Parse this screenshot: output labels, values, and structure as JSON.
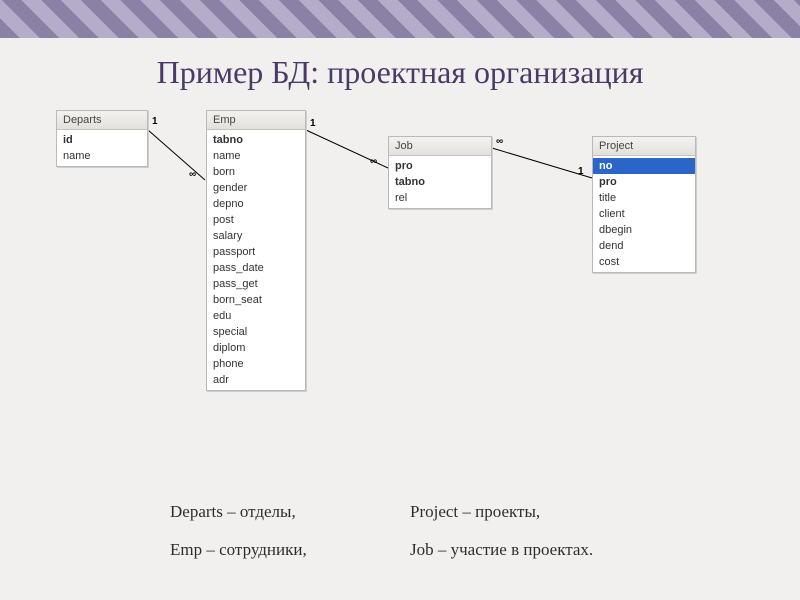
{
  "title": "Пример БД: проектная организация",
  "tables": {
    "departs": {
      "name": "Departs",
      "fields": [
        {
          "name": "id",
          "pk": true
        },
        {
          "name": "name"
        }
      ]
    },
    "emp": {
      "name": "Emp",
      "fields": [
        {
          "name": "tabno",
          "pk": true
        },
        {
          "name": "name"
        },
        {
          "name": "born"
        },
        {
          "name": "gender"
        },
        {
          "name": "depno"
        },
        {
          "name": "post"
        },
        {
          "name": "salary"
        },
        {
          "name": "passport"
        },
        {
          "name": "pass_date"
        },
        {
          "name": "pass_get"
        },
        {
          "name": "born_seat"
        },
        {
          "name": "edu"
        },
        {
          "name": "special"
        },
        {
          "name": "diplom"
        },
        {
          "name": "phone"
        },
        {
          "name": "adr"
        }
      ]
    },
    "job": {
      "name": "Job",
      "fields": [
        {
          "name": "pro",
          "pk": true
        },
        {
          "name": "tabno",
          "pk": true
        },
        {
          "name": "rel"
        }
      ]
    },
    "project": {
      "name": "Project",
      "fields": [
        {
          "name": "no",
          "pk": true,
          "selected": true
        },
        {
          "name": "pro",
          "pk": true
        },
        {
          "name": "title"
        },
        {
          "name": "client"
        },
        {
          "name": "dbegin"
        },
        {
          "name": "dend"
        },
        {
          "name": "cost"
        }
      ]
    }
  },
  "cardinality": {
    "one": "1",
    "many": "∞"
  },
  "legend": {
    "departs": "Departs – отделы,",
    "project": "Project – проекты,",
    "emp": "Emp – сотрудники,",
    "job": "Job – участие в проектах."
  }
}
